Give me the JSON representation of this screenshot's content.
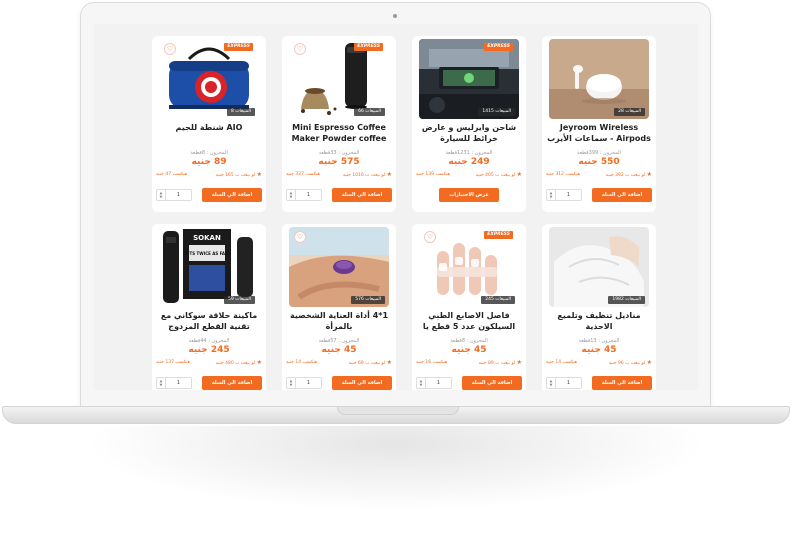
{
  "badges": {
    "express": "EXPRESS"
  },
  "colors": {
    "accent": "#f36b21",
    "background": "#f2f2f2"
  },
  "products": [
    {
      "title": "Jeyroom Wireless Airpods - سماعات الأيرب",
      "orders": "المبيعات 28",
      "stock": "المخزون : 399قطعة",
      "price": "550 جنيه",
      "earn": "لو بيعت ب 392 جنيه",
      "profit": "هتكسب 312 جنيه",
      "button": "اضافة الي السلة",
      "qty": "1",
      "image": "airpods"
    },
    {
      "title": "شاحن وايرليس و عارض خرائط للسيارة",
      "orders": "المبيعات 1415",
      "stock": "المخزون : 1231قطعة",
      "price": "249 جنيه",
      "earn": "لو بيعت ب 405 جنيه",
      "profit": "هتكسب 139 جنيه",
      "button": "عرض الاختيارات",
      "qty": "",
      "image": "car-display"
    },
    {
      "title": "Mini Espresso Coffee Maker Powder coffee",
      "orders": "المبيعات 66",
      "stock": "المخزون : 33قطعة",
      "price": "575 جنيه",
      "earn": "لو بيعت ب 1016 جنيه",
      "profit": "هتكسب 327 جنيه",
      "button": "اضافة الي السلة",
      "qty": "1",
      "image": "espresso"
    },
    {
      "title": "AIO شنطة للجيم",
      "orders": "المبيعات 8",
      "stock": "المخزون : 8قطعة",
      "price": "89 جنيه",
      "earn": "لو بيعت ب 165 جنيه",
      "profit": "هتكسب 47 جنيه",
      "button": "اضافة الي السلة",
      "qty": "1",
      "image": "gym-bag"
    },
    {
      "title": "مناديل تنظيف وتلميع الاحذية",
      "orders": "المبيعات 1982",
      "stock": "المخزون : 13قطعة",
      "price": "45 جنيه",
      "earn": "لو بيعت ب 96 جنيه",
      "profit": "هتكسب 14 جنيه",
      "button": "اضافة الي السلة",
      "qty": "1",
      "image": "wipes"
    },
    {
      "title": "فاصل الاصابع الطبي السيلكون عدد 5 قطع يا",
      "orders": "المبيعات 245",
      "stock": "المخزون : 8قطعة",
      "price": "45 جنيه",
      "earn": "لو بيعت ب 89 جنيه",
      "profit": "هتكسب 16 جنيه",
      "button": "اضافة الي السلة",
      "qty": "1",
      "image": "toe-separator"
    },
    {
      "title": "1*4 أداة العناية الشخصية بالمرأة",
      "orders": "المبيعات 576",
      "stock": "المخزون : 57قطعة",
      "price": "45 جنيه",
      "earn": "لو بيعت ب 69 جنيه",
      "profit": "هتكسب 14 جنيه",
      "button": "اضافة الي السلة",
      "qty": "1",
      "image": "beauty-tool"
    },
    {
      "title": "ماكينة حلاقة سوكاني مع تقنية القطع المزدوج",
      "orders": "المبيعات 59",
      "stock": "المخزون : 44قطعة",
      "price": "245 جنيه",
      "earn": "لو بيعت ب 480 جنيه",
      "profit": "هتكسب 137 جنيه",
      "button": "اضافة الي السلة",
      "qty": "1",
      "image": "shaver"
    }
  ],
  "shaver_box_text": "SOKAN",
  "shaver_box_subtext": "CUTS TWICE AS FAST"
}
